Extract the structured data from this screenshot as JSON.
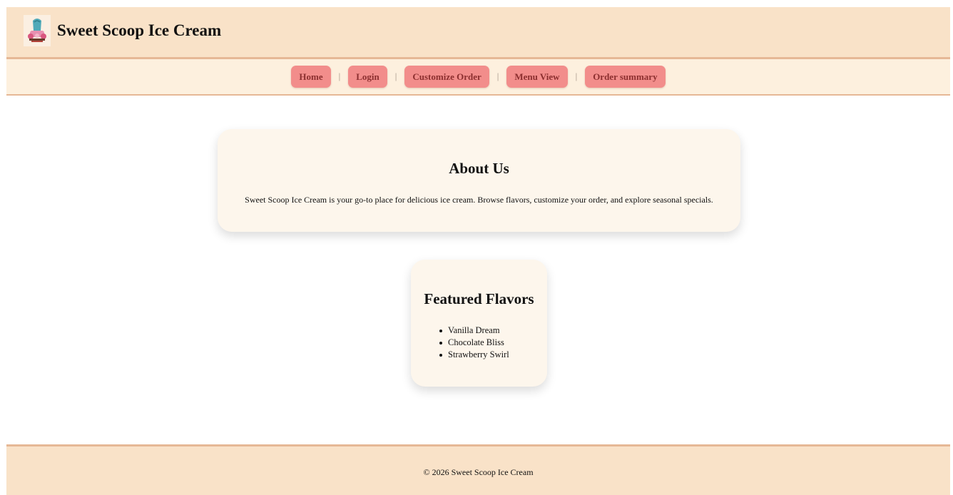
{
  "header": {
    "logo_icon": "ice-cream-logo-icon",
    "site_title": "Sweet Scoop Ice Cream"
  },
  "nav": {
    "items": [
      {
        "label": "Home"
      },
      {
        "label": "Login"
      },
      {
        "label": "Customize Order"
      },
      {
        "label": "Menu View"
      },
      {
        "label": "Order summary"
      }
    ],
    "separator": "|"
  },
  "about": {
    "heading": "About Us",
    "text": "Sweet Scoop Ice Cream is your go-to place for delicious ice cream. Browse flavors, customize your order, and explore seasonal specials."
  },
  "featured": {
    "heading": "Featured Flavors",
    "items": [
      "Vanilla Dream",
      "Chocolate Bliss",
      "Strawberry Swirl"
    ]
  },
  "footer": {
    "text": "© 2026 Sweet Scoop Ice Cream"
  },
  "colors": {
    "header_bg": "#f9e2c8",
    "nav_bg": "#fdf0de",
    "border": "#e6b896",
    "nav_button": "#f28d8b",
    "nav_button_text": "#8c2f2f",
    "card_bg": "#fdf6ec"
  }
}
